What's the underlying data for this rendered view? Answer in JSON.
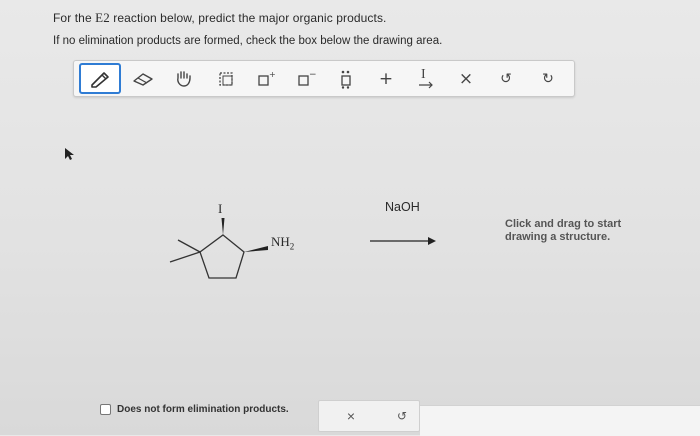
{
  "question": {
    "line1_pre": "For the ",
    "line1_math": "E2",
    "line1_post": " reaction below, predict the major organic products.",
    "line2": "If no elimination products are formed, check the box below the drawing area."
  },
  "toolbar": {
    "tools": [
      {
        "name": "pencil-icon",
        "active": true
      },
      {
        "name": "eraser-icon"
      },
      {
        "name": "hand-icon"
      },
      {
        "name": "select-box-icon"
      },
      {
        "name": "positive-charge-icon"
      },
      {
        "name": "negative-charge-icon"
      },
      {
        "name": "lone-pair-icon"
      },
      {
        "name": "plus-icon",
        "label": "+"
      },
      {
        "name": "text-arrow-icon",
        "label": "I"
      },
      {
        "name": "clear-icon",
        "label": "×"
      },
      {
        "name": "undo-icon",
        "label": "↺"
      },
      {
        "name": "redo-icon",
        "label": "↻"
      }
    ]
  },
  "reaction": {
    "substituent_top": "I",
    "substituent_right": "NH",
    "substituent_right_sub": "2",
    "reagent": "NaOH"
  },
  "hint": "Click and drag to start drawing a structure.",
  "checkbox": {
    "label": "Does not form elimination products.",
    "checked": false
  },
  "bottom_controls": {
    "clear": "×",
    "undo": "↺"
  }
}
